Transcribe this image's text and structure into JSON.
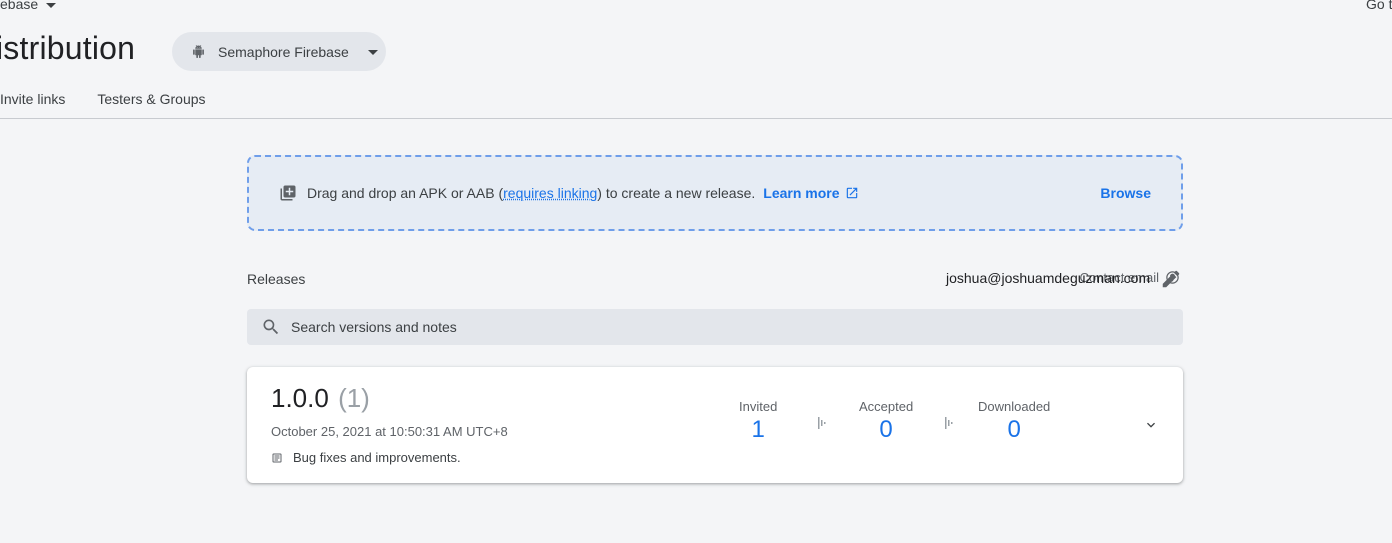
{
  "header": {
    "breadcrumb": "ebase",
    "goto": "Go to",
    "title": "istribution",
    "app_select": {
      "label": "Semaphore Firebase",
      "icon": "android-icon"
    }
  },
  "tabs": [
    {
      "label": "Invite links"
    },
    {
      "label": "Testers & Groups"
    }
  ],
  "dropzone": {
    "text_before": "Drag and drop an APK or AAB (",
    "link": "requires linking",
    "text_after": ") to create a new release.",
    "learn_more": "Learn more",
    "browse": "Browse"
  },
  "releases": {
    "label": "Releases",
    "contact_label": "Contact email",
    "contact_email": "joshua@joshuamdeguzman.com",
    "search_placeholder": "Search versions and notes",
    "items": [
      {
        "version": "1.0.0",
        "build": "(1)",
        "date": "October 25, 2021 at 10:50:31 AM UTC+8",
        "notes": "Bug fixes and improvements.",
        "stats": [
          {
            "label": "Invited",
            "value": "1"
          },
          {
            "label": "Accepted",
            "value": "0"
          },
          {
            "label": "Downloaded",
            "value": "0"
          }
        ]
      }
    ]
  },
  "colors": {
    "accent": "#1a73e8",
    "background": "#f4f5f7",
    "dropzone_bg": "#e6ecf4"
  }
}
